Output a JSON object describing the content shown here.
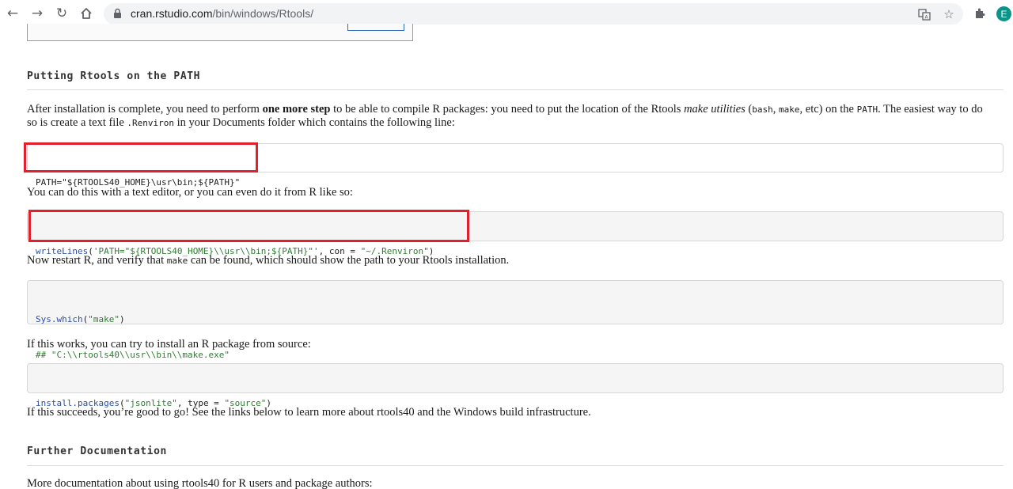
{
  "browser": {
    "url_host": "cran.rstudio.com",
    "url_path": "/bin/windows/Rtools/",
    "avatar_letter": "E",
    "icons": [
      "back-arrow-icon",
      "forward-arrow-icon",
      "reload-icon",
      "home-icon",
      "lock-icon",
      "translate-icon",
      "star-icon",
      "extensions-icon"
    ]
  },
  "section1": {
    "heading": "Putting Rtools on the PATH",
    "para1": {
      "a": "After installation is complete, you need to perform ",
      "bold": "one more step",
      "b": " to be able to compile R packages: you need to put the location of the Rtools ",
      "em": "make utilities",
      "c": " (",
      "code1": "bash",
      "d": ", ",
      "code2": "make",
      "e": ", etc) on the ",
      "code3": "PATH",
      "f": ". The easiest way to do so is create a text file ",
      "code4": ".Renviron",
      "g": " in your Documents folder which contains the following line:"
    },
    "code1_line": "PATH=\"${RTOOLS40_HOME}\\usr\\bin;${PATH}\"",
    "para2": "You can do this with a text editor, or you can even do it from R like so:",
    "code2": {
      "fn": "writeLines",
      "a": "(",
      "str1": "'PATH=\"${RTOOLS40_HOME}\\\\usr\\\\bin;${PATH}\"'",
      "b": ", con = ",
      "str2": "\"~/.Renviron\"",
      "c": ")"
    },
    "para3": {
      "a": "Now restart R, and verify that ",
      "code": "make",
      "b": " can be found, which should show the path to your Rtools installation."
    },
    "code3": {
      "fn": "Sys.which",
      "a": "(",
      "str": "\"make\"",
      "b": ")",
      "comment": "## \"C:\\\\rtools40\\\\usr\\\\bin\\\\make.exe\""
    },
    "para4": "If this works, you can try to install an R package from source:",
    "code4": {
      "fn": "install.packages",
      "a": "(",
      "str1": "\"jsonlite\"",
      "b": ", type = ",
      "str2": "\"source\"",
      "c": ")"
    },
    "para5": "If this succeeds, you’re good to go! See the links below to learn more about rtools40 and the Windows build infrastructure."
  },
  "section2": {
    "heading": "Further Documentation",
    "para1": "More documentation about using rtools40 for R users and package authors:"
  },
  "colors": {
    "highlight": "#e0202a",
    "code_fn": "#2b4fa8",
    "code_str": "#2f7d32",
    "avatar": "#0d9488"
  }
}
